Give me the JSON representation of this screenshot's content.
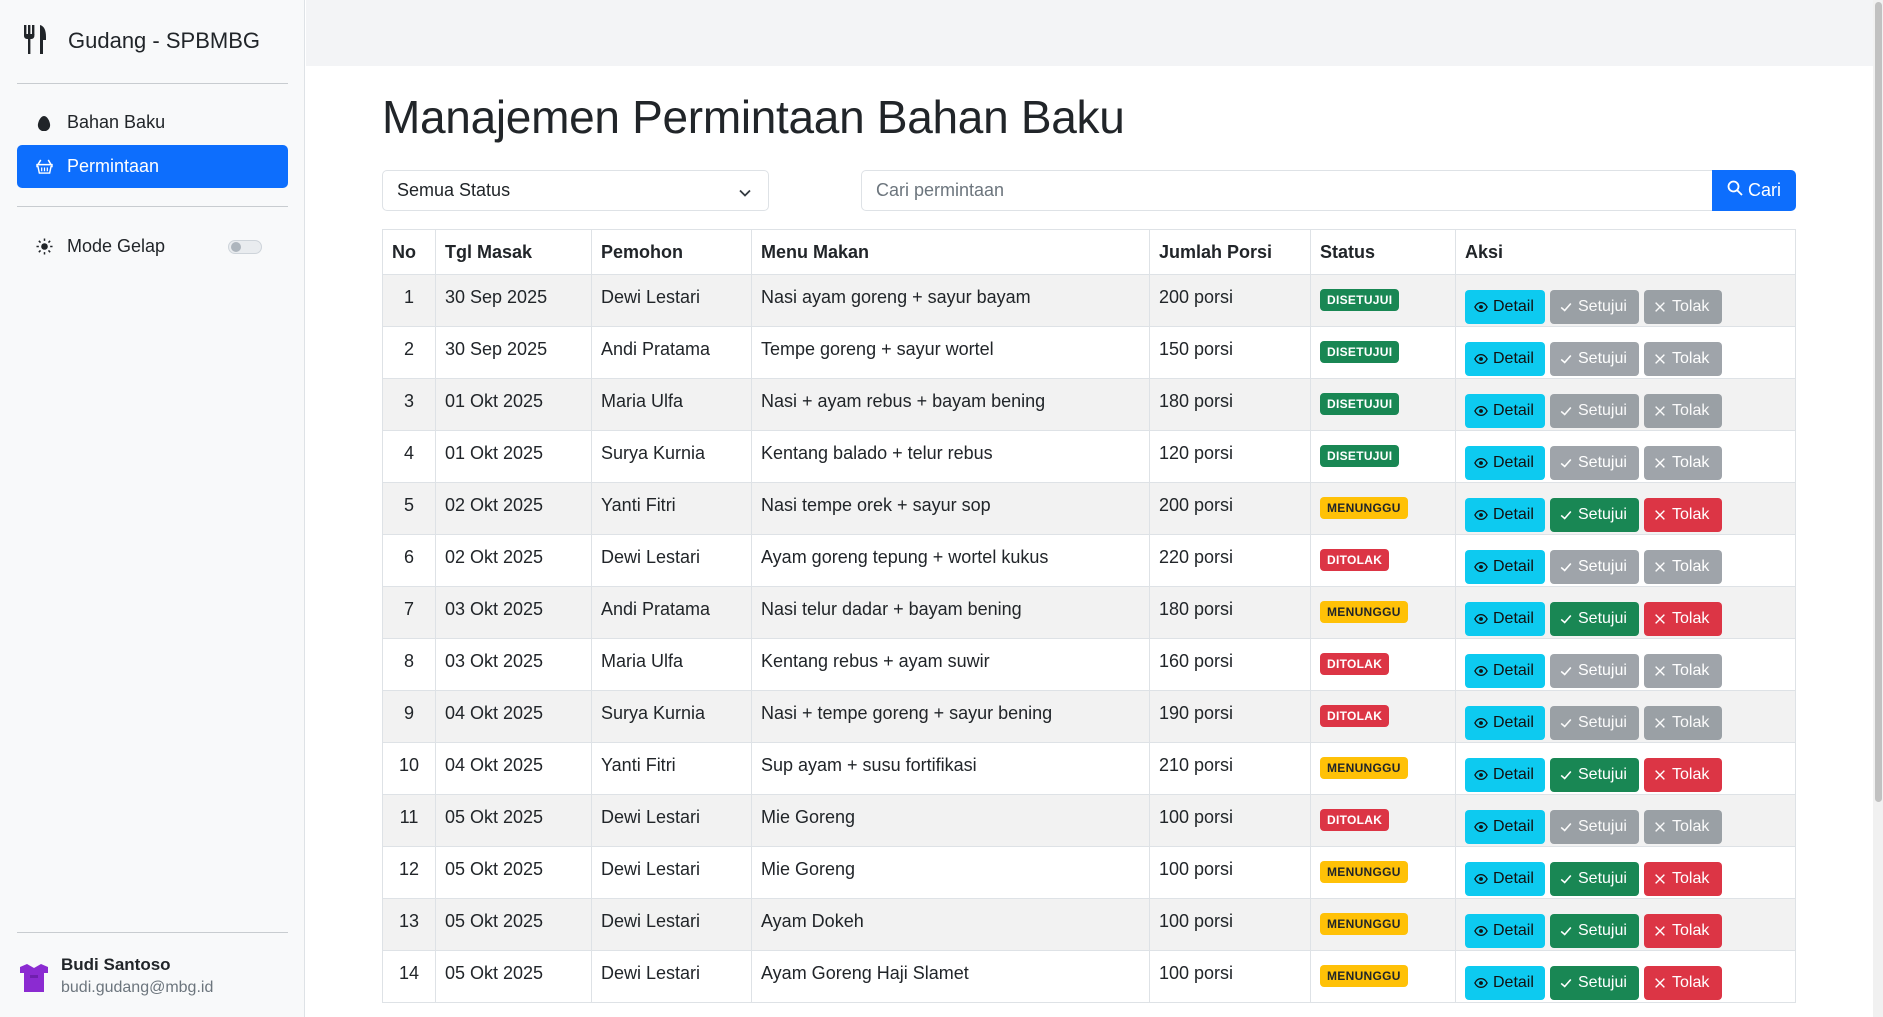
{
  "app": {
    "title": "Gudang - SPBMBG"
  },
  "sidebar": {
    "items": [
      {
        "label": "Bahan Baku",
        "icon": "egg-icon",
        "active": false
      },
      {
        "label": "Permintaan",
        "icon": "basket-icon",
        "active": true
      }
    ],
    "dark_mode_label": "Mode Gelap",
    "dark_mode_on": false
  },
  "user": {
    "name": "Budi Santoso",
    "email": "budi.gudang@mbg.id"
  },
  "page": {
    "title": "Manajemen Permintaan Bahan Baku"
  },
  "filter": {
    "selected": "Semua Status"
  },
  "search": {
    "placeholder": "Cari permintaan",
    "button_label": "Cari"
  },
  "table": {
    "headers": [
      "No",
      "Tgl Masak",
      "Pemohon",
      "Menu Makan",
      "Jumlah Porsi",
      "Status",
      "Aksi"
    ],
    "action_labels": {
      "detail": "Detail",
      "approve": "Setujui",
      "reject": "Tolak"
    },
    "rows": [
      {
        "no": "1",
        "date": "30 Sep 2025",
        "requester": "Dewi Lestari",
        "menu": "Nasi ayam goreng + sayur bayam",
        "portions": "200 porsi",
        "status": "DISETUJUI"
      },
      {
        "no": "2",
        "date": "30 Sep 2025",
        "requester": "Andi Pratama",
        "menu": "Tempe goreng + sayur wortel",
        "portions": "150 porsi",
        "status": "DISETUJUI"
      },
      {
        "no": "3",
        "date": "01 Okt 2025",
        "requester": "Maria Ulfa",
        "menu": "Nasi + ayam rebus + bayam bening",
        "portions": "180 porsi",
        "status": "DISETUJUI"
      },
      {
        "no": "4",
        "date": "01 Okt 2025",
        "requester": "Surya Kurnia",
        "menu": "Kentang balado + telur rebus",
        "portions": "120 porsi",
        "status": "DISETUJUI"
      },
      {
        "no": "5",
        "date": "02 Okt 2025",
        "requester": "Yanti Fitri",
        "menu": "Nasi tempe orek + sayur sop",
        "portions": "200 porsi",
        "status": "MENUNGGU"
      },
      {
        "no": "6",
        "date": "02 Okt 2025",
        "requester": "Dewi Lestari",
        "menu": "Ayam goreng tepung + wortel kukus",
        "portions": "220 porsi",
        "status": "DITOLAK"
      },
      {
        "no": "7",
        "date": "03 Okt 2025",
        "requester": "Andi Pratama",
        "menu": "Nasi telur dadar + bayam bening",
        "portions": "180 porsi",
        "status": "MENUNGGU"
      },
      {
        "no": "8",
        "date": "03 Okt 2025",
        "requester": "Maria Ulfa",
        "menu": "Kentang rebus + ayam suwir",
        "portions": "160 porsi",
        "status": "DITOLAK"
      },
      {
        "no": "9",
        "date": "04 Okt 2025",
        "requester": "Surya Kurnia",
        "menu": "Nasi + tempe goreng + sayur bening",
        "portions": "190 porsi",
        "status": "DITOLAK"
      },
      {
        "no": "10",
        "date": "04 Okt 2025",
        "requester": "Yanti Fitri",
        "menu": "Sup ayam + susu fortifikasi",
        "portions": "210 porsi",
        "status": "MENUNGGU"
      },
      {
        "no": "11",
        "date": "05 Okt 2025",
        "requester": "Dewi Lestari",
        "menu": "Mie Goreng",
        "portions": "100 porsi",
        "status": "DITOLAK"
      },
      {
        "no": "12",
        "date": "05 Okt 2025",
        "requester": "Dewi Lestari",
        "menu": "Mie Goreng",
        "portions": "100 porsi",
        "status": "MENUNGGU"
      },
      {
        "no": "13",
        "date": "05 Okt 2025",
        "requester": "Dewi Lestari",
        "menu": "Ayam Dokeh",
        "portions": "100 porsi",
        "status": "MENUNGGU"
      },
      {
        "no": "14",
        "date": "05 Okt 2025",
        "requester": "Dewi Lestari",
        "menu": "Ayam Goreng Haji Slamet",
        "portions": "100 porsi",
        "status": "MENUNGGU"
      }
    ]
  },
  "colors": {
    "primary": "#0d6efd",
    "info": "#0dcaf0",
    "success": "#198754",
    "warning": "#ffc107",
    "danger": "#dc3545",
    "secondary": "#6c757d"
  }
}
